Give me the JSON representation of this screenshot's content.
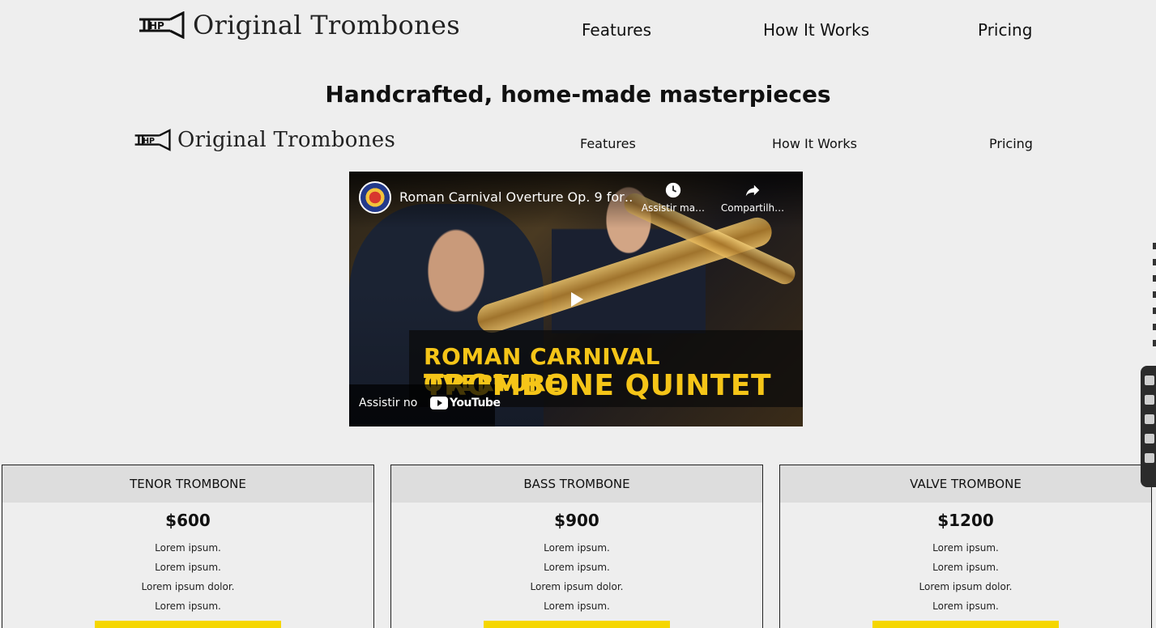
{
  "brand": {
    "name": "Original Trombones",
    "logo_icon": "trombone-logo-icon"
  },
  "nav_primary": {
    "features": "Features",
    "how_it_works": "How It Works",
    "pricing": "Pricing"
  },
  "hero": {
    "title": "Handcrafted, home-made masterpieces"
  },
  "nav_secondary": {
    "features": "Features",
    "how_it_works": "How It Works",
    "pricing": "Pricing"
  },
  "video": {
    "title": "Roman Carnival Overture Op. 9 for…",
    "watch_later": "Assistir ma…",
    "share": "Compartilh…",
    "banner_line1": "ROMAN CARNIVAL OVERTURE",
    "banner_line2": "TROMBONE QUINTET",
    "watch_on": "Assistir no",
    "youtube": "YouTube"
  },
  "pricing": [
    {
      "name": "TENOR TROMBONE",
      "price": "$600",
      "features": [
        "Lorem ipsum.",
        "Lorem ipsum.",
        "Lorem ipsum dolor.",
        "Lorem ipsum."
      ]
    },
    {
      "name": "BASS TROMBONE",
      "price": "$900",
      "features": [
        "Lorem ipsum.",
        "Lorem ipsum.",
        "Lorem ipsum dolor.",
        "Lorem ipsum."
      ]
    },
    {
      "name": "VALVE TROMBONE",
      "price": "$1200",
      "features": [
        "Lorem ipsum.",
        "Lorem ipsum.",
        "Lorem ipsum dolor.",
        "Lorem ipsum."
      ]
    }
  ],
  "colors": {
    "background": "#eeeeee",
    "card_header": "#dddddd",
    "button": "#f5d600",
    "banner_text": "#f5c518"
  }
}
